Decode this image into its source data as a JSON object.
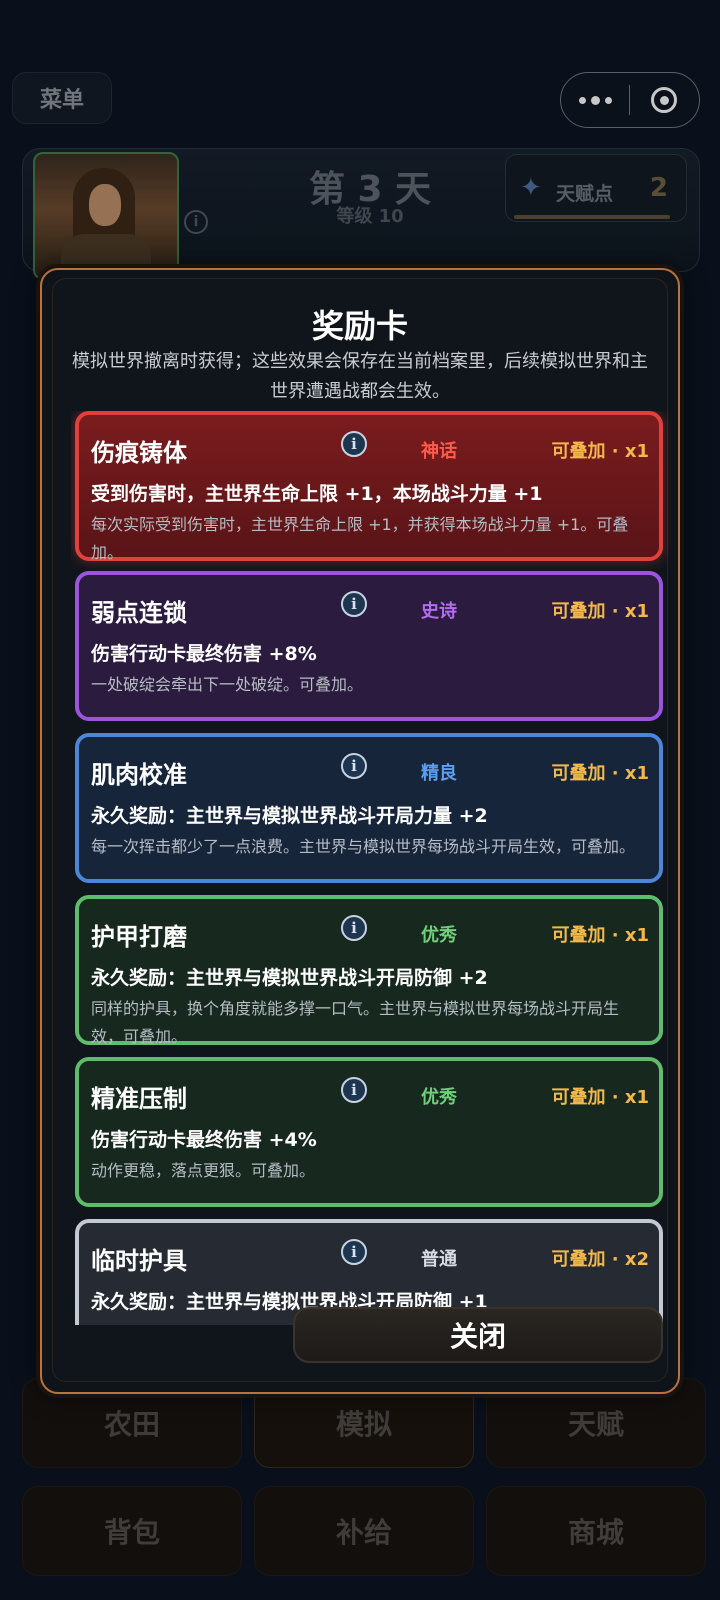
{
  "topbar": {
    "menu_label": "菜单"
  },
  "header": {
    "day_title": "第 3 天",
    "level": "等级 10",
    "talent_label": "天赋点",
    "talent_points": "2"
  },
  "bottom_nav": {
    "tabs": [
      "农田",
      "模拟",
      "天赋",
      "背包",
      "补给",
      "商城"
    ],
    "active_tab": "模拟"
  },
  "modal": {
    "title": "奖励卡",
    "description": "模拟世界撤离时获得；这些效果会保存在当前档案里，后续模拟世界和主世界遭遇战都会生效。",
    "close_label": "关闭",
    "cards": [
      {
        "name": "伤痕铸体",
        "rarity": "神话",
        "stack": "可叠加 · x1",
        "effect": "受到伤害时，主世界生命上限 +1，本场战斗力量 +1",
        "flavor": "每次实际受到伤害时，主世界生命上限 +1，并获得本场战斗力量 +1。可叠加。"
      },
      {
        "name": "弱点连锁",
        "rarity": "史诗",
        "stack": "可叠加 · x1",
        "effect": "伤害行动卡最终伤害 +8%",
        "flavor": "一处破绽会牵出下一处破绽。可叠加。"
      },
      {
        "name": "肌肉校准",
        "rarity": "精良",
        "stack": "可叠加 · x1",
        "effect": "永久奖励：主世界与模拟世界战斗开局力量 +2",
        "flavor": "每一次挥击都少了一点浪费。主世界与模拟世界每场战斗开局生效，可叠加。"
      },
      {
        "name": "护甲打磨",
        "rarity": "优秀",
        "stack": "可叠加 · x1",
        "effect": "永久奖励：主世界与模拟世界战斗开局防御 +2",
        "flavor": "同样的护具，换个角度就能多撑一口气。主世界与模拟世界每场战斗开局生效，可叠加。"
      },
      {
        "name": "精准压制",
        "rarity": "优秀",
        "stack": "可叠加 · x1",
        "effect": "伤害行动卡最终伤害 +4%",
        "flavor": "动作更稳，落点更狠。可叠加。"
      },
      {
        "name": "临时护具",
        "rarity": "普通",
        "stack": "可叠加 · x2",
        "effect": "永久奖励：主世界与模拟世界战斗开局防御 +1",
        "flavor": ""
      }
    ]
  }
}
